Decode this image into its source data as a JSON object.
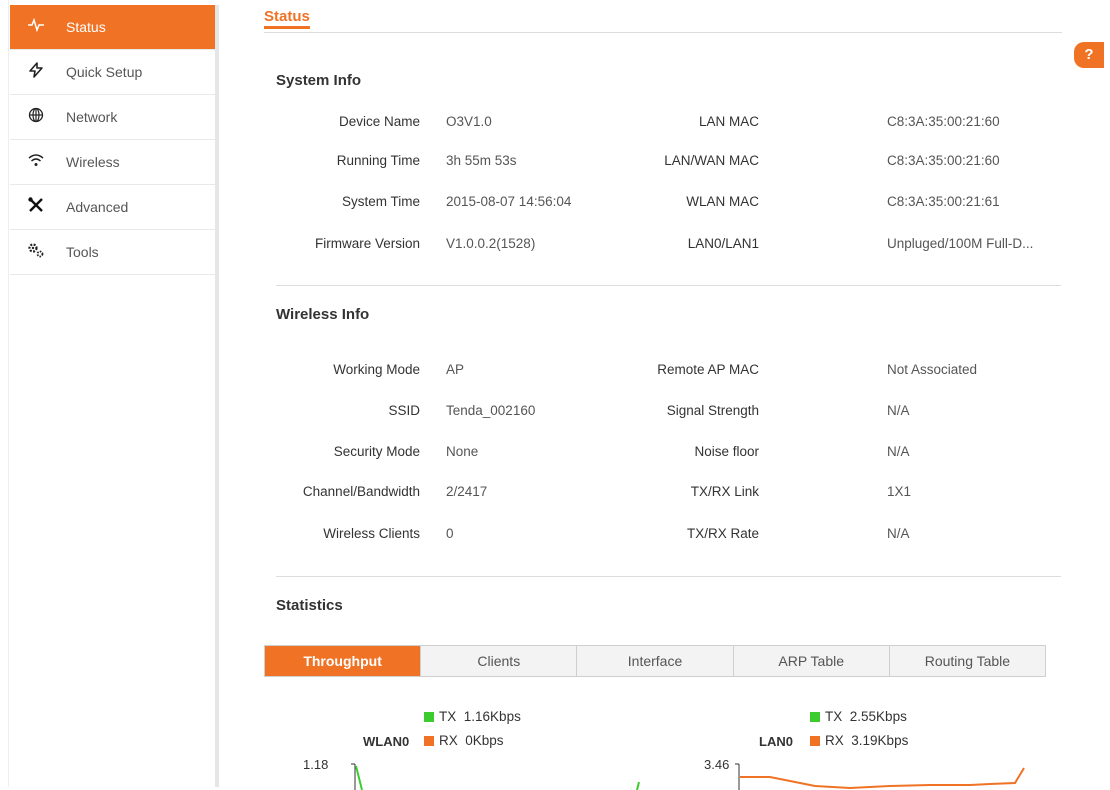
{
  "sidebar": {
    "items": [
      {
        "label": "Status",
        "icon": "pulse-icon",
        "active": true
      },
      {
        "label": "Quick Setup",
        "icon": "bolt-icon"
      },
      {
        "label": "Network",
        "icon": "globe-icon"
      },
      {
        "label": "Wireless",
        "icon": "wifi-icon"
      },
      {
        "label": "Advanced",
        "icon": "tools-icon"
      },
      {
        "label": "Tools",
        "icon": "gears-icon"
      }
    ]
  },
  "page": {
    "title": "Status",
    "help": "?"
  },
  "system_info": {
    "title": "System Info",
    "left": [
      {
        "label": "Device Name",
        "value": "O3V1.0"
      },
      {
        "label": "Running Time",
        "value": "3h 55m 53s"
      },
      {
        "label": "System Time",
        "value": "2015-08-07 14:56:04"
      },
      {
        "label": "Firmware Version",
        "value": "V1.0.0.2(1528)"
      }
    ],
    "right": [
      {
        "label": "LAN MAC",
        "value": "C8:3A:35:00:21:60"
      },
      {
        "label": "LAN/WAN MAC",
        "value": "C8:3A:35:00:21:60"
      },
      {
        "label": "WLAN MAC",
        "value": "C8:3A:35:00:21:61"
      },
      {
        "label": "LAN0/LAN1",
        "value": "Unpluged/100M Full-D..."
      }
    ]
  },
  "wireless_info": {
    "title": "Wireless Info",
    "left": [
      {
        "label": "Working Mode",
        "value": "AP"
      },
      {
        "label": "SSID",
        "value": "Tenda_002160"
      },
      {
        "label": "Security Mode",
        "value": "None"
      },
      {
        "label": "Channel/Bandwidth",
        "value": "2/2417"
      },
      {
        "label": "Wireless Clients",
        "value": "0"
      }
    ],
    "right": [
      {
        "label": "Remote AP MAC",
        "value": "Not Associated"
      },
      {
        "label": "Signal Strength",
        "value": "N/A"
      },
      {
        "label": "Noise floor",
        "value": "N/A"
      },
      {
        "label": "TX/RX Link",
        "value": "1X1"
      },
      {
        "label": "TX/RX Rate",
        "value": "N/A"
      }
    ]
  },
  "statistics": {
    "title": "Statistics",
    "tabs": [
      "Throughput",
      "Clients",
      "Interface",
      "ARP Table",
      "Routing Table"
    ],
    "active_tab": "Throughput"
  },
  "charts": {
    "wlan": {
      "name": "WLAN0",
      "tx_label": "TX",
      "tx_value": "1.16Kbps",
      "rx_label": "RX",
      "rx_value": "0Kbps",
      "ymax": "1.18"
    },
    "lan": {
      "name": "LAN0",
      "tx_label": "TX",
      "tx_value": "2.55Kbps",
      "rx_label": "RX",
      "rx_value": "3.19Kbps",
      "ymax": "3.46"
    }
  },
  "colors": {
    "accent": "#f07224",
    "tx": "#3dcc2f",
    "rx": "#f07224"
  }
}
